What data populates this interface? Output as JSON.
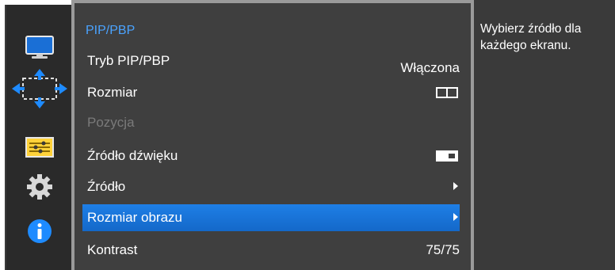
{
  "rail": {
    "items": [
      {
        "icon": "monitor-icon"
      },
      {
        "icon": "screen-size-arrows-icon"
      },
      {
        "icon": "pip-settings-icon"
      },
      {
        "icon": "gear-icon"
      },
      {
        "icon": "info-icon"
      }
    ]
  },
  "menu": {
    "title": "PIP/PBP",
    "rows": [
      {
        "label": "Tryb PIP/PBP",
        "value": "Włączona"
      },
      {
        "label": "Rozmiar",
        "value_icon": "pbp-split-icon"
      },
      {
        "label": "Pozycja"
      },
      {
        "label": "Źródło dźwięku",
        "value_icon": "sound-source-icon"
      },
      {
        "label": "Źródło",
        "value_icon": "chevron-right-icon"
      },
      {
        "label": "Rozmiar obrazu",
        "value_icon": "chevron-right-icon"
      },
      {
        "label": "Kontrast",
        "value": "75/75"
      }
    ]
  },
  "help": {
    "text": "Wybierz źródło dla każdego ekranu."
  },
  "colors": {
    "accent": "#1f7fe5",
    "title": "#4aa3ff",
    "panel": "#3f3f3f",
    "disabled_text": "#7a7a7a"
  }
}
